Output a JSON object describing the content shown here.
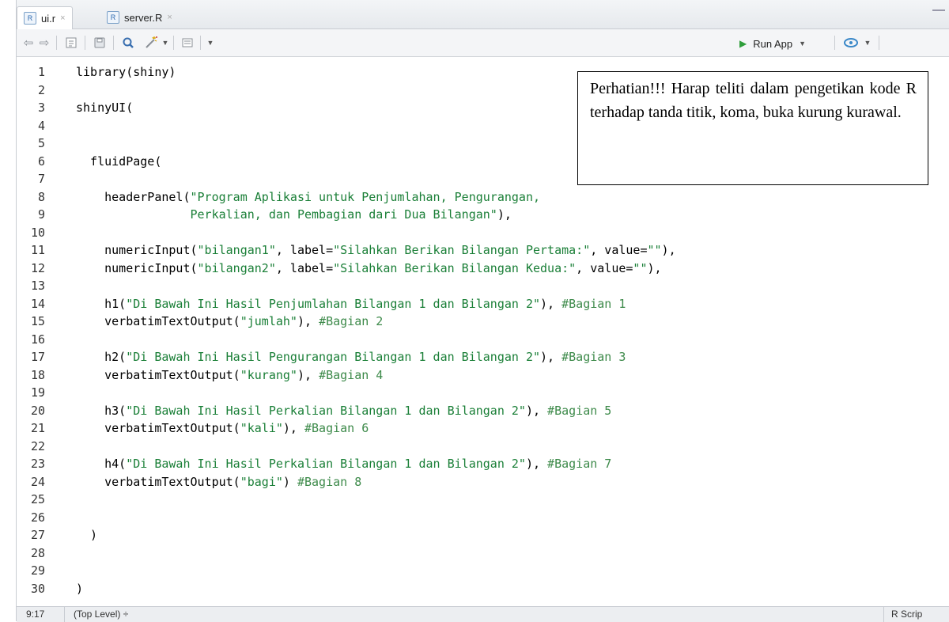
{
  "tabs": [
    {
      "label": "ui.r",
      "close": "×",
      "active": true
    },
    {
      "label": "server.R",
      "close": "×",
      "active": false
    }
  ],
  "toolbar": {
    "run_label": "Run App",
    "icons": [
      "back-icon",
      "forward-icon",
      "source-icon",
      "save-icon",
      "search-icon",
      "magic-wand-icon",
      "compile-report-icon",
      "more-icon"
    ]
  },
  "note": "Perhatian!!! Harap teliti dalam pengetikan kode R terhadap tanda titik, koma, buka kurung kurawal.",
  "code": [
    {
      "n": "1",
      "parts": [
        {
          "t": "library(shiny)",
          "k": "p"
        }
      ]
    },
    {
      "n": "2",
      "parts": []
    },
    {
      "n": "3",
      "parts": [
        {
          "t": "shinyUI(",
          "k": "p"
        }
      ]
    },
    {
      "n": "4",
      "parts": []
    },
    {
      "n": "5",
      "parts": []
    },
    {
      "n": "6",
      "parts": [
        {
          "t": "  fluidPage(",
          "k": "p"
        }
      ]
    },
    {
      "n": "7",
      "parts": []
    },
    {
      "n": "8",
      "parts": [
        {
          "t": "    headerPanel(",
          "k": "p"
        },
        {
          "t": "\"Program Aplikasi untuk Penjumlahan, Pengurangan,",
          "k": "s"
        }
      ]
    },
    {
      "n": "9",
      "parts": [
        {
          "t": "                Perkalian, dan Pembagian dari Dua Bilangan\"",
          "k": "s"
        },
        {
          "t": "),",
          "k": "p"
        }
      ]
    },
    {
      "n": "10",
      "parts": []
    },
    {
      "n": "11",
      "parts": [
        {
          "t": "    numericInput(",
          "k": "p"
        },
        {
          "t": "\"bilangan1\"",
          "k": "s"
        },
        {
          "t": ", label=",
          "k": "p"
        },
        {
          "t": "\"Silahkan Berikan Bilangan Pertama:\"",
          "k": "s"
        },
        {
          "t": ", value=",
          "k": "p"
        },
        {
          "t": "\"\"",
          "k": "s"
        },
        {
          "t": "),",
          "k": "p"
        }
      ]
    },
    {
      "n": "12",
      "parts": [
        {
          "t": "    numericInput(",
          "k": "p"
        },
        {
          "t": "\"bilangan2\"",
          "k": "s"
        },
        {
          "t": ", label=",
          "k": "p"
        },
        {
          "t": "\"Silahkan Berikan Bilangan Kedua:\"",
          "k": "s"
        },
        {
          "t": ", value=",
          "k": "p"
        },
        {
          "t": "\"\"",
          "k": "s"
        },
        {
          "t": "),",
          "k": "p"
        }
      ]
    },
    {
      "n": "13",
      "parts": []
    },
    {
      "n": "14",
      "parts": [
        {
          "t": "    h1(",
          "k": "p"
        },
        {
          "t": "\"Di Bawah Ini Hasil Penjumlahan Bilangan 1 dan Bilangan 2\"",
          "k": "s"
        },
        {
          "t": "), ",
          "k": "p"
        },
        {
          "t": "#Bagian 1",
          "k": "c"
        }
      ]
    },
    {
      "n": "15",
      "parts": [
        {
          "t": "    verbatimTextOutput(",
          "k": "p"
        },
        {
          "t": "\"jumlah\"",
          "k": "s"
        },
        {
          "t": "), ",
          "k": "p"
        },
        {
          "t": "#Bagian 2",
          "k": "c"
        }
      ]
    },
    {
      "n": "16",
      "parts": []
    },
    {
      "n": "17",
      "parts": [
        {
          "t": "    h2(",
          "k": "p"
        },
        {
          "t": "\"Di Bawah Ini Hasil Pengurangan Bilangan 1 dan Bilangan 2\"",
          "k": "s"
        },
        {
          "t": "), ",
          "k": "p"
        },
        {
          "t": "#Bagian 3",
          "k": "c"
        }
      ]
    },
    {
      "n": "18",
      "parts": [
        {
          "t": "    verbatimTextOutput(",
          "k": "p"
        },
        {
          "t": "\"kurang\"",
          "k": "s"
        },
        {
          "t": "), ",
          "k": "p"
        },
        {
          "t": "#Bagian 4",
          "k": "c"
        }
      ]
    },
    {
      "n": "19",
      "parts": []
    },
    {
      "n": "20",
      "parts": [
        {
          "t": "    h3(",
          "k": "p"
        },
        {
          "t": "\"Di Bawah Ini Hasil Perkalian Bilangan 1 dan Bilangan 2\"",
          "k": "s"
        },
        {
          "t": "), ",
          "k": "p"
        },
        {
          "t": "#Bagian 5",
          "k": "c"
        }
      ]
    },
    {
      "n": "21",
      "parts": [
        {
          "t": "    verbatimTextOutput(",
          "k": "p"
        },
        {
          "t": "\"kali\"",
          "k": "s"
        },
        {
          "t": "), ",
          "k": "p"
        },
        {
          "t": "#Bagian 6",
          "k": "c"
        }
      ]
    },
    {
      "n": "22",
      "parts": []
    },
    {
      "n": "23",
      "parts": [
        {
          "t": "    h4(",
          "k": "p"
        },
        {
          "t": "\"Di Bawah Ini Hasil Perkalian Bilangan 1 dan Bilangan 2\"",
          "k": "s"
        },
        {
          "t": "), ",
          "k": "p"
        },
        {
          "t": "#Bagian 7",
          "k": "c"
        }
      ]
    },
    {
      "n": "24",
      "parts": [
        {
          "t": "    verbatimTextOutput(",
          "k": "p"
        },
        {
          "t": "\"bagi\"",
          "k": "s"
        },
        {
          "t": ") ",
          "k": "p"
        },
        {
          "t": "#Bagian 8",
          "k": "c"
        }
      ]
    },
    {
      "n": "25",
      "parts": []
    },
    {
      "n": "26",
      "parts": []
    },
    {
      "n": "27",
      "parts": [
        {
          "t": "  )",
          "k": "p"
        }
      ]
    },
    {
      "n": "28",
      "parts": []
    },
    {
      "n": "29",
      "parts": []
    },
    {
      "n": "30",
      "parts": [
        {
          "t": ")",
          "k": "p"
        }
      ]
    }
  ],
  "status": {
    "position": "9:17",
    "scope": "(Top Level) ÷",
    "filetype": "R Scrip"
  },
  "colors": {
    "string": "#1a7f37",
    "comment": "#3d8a4a",
    "run_icon": "#2e9e3b"
  }
}
